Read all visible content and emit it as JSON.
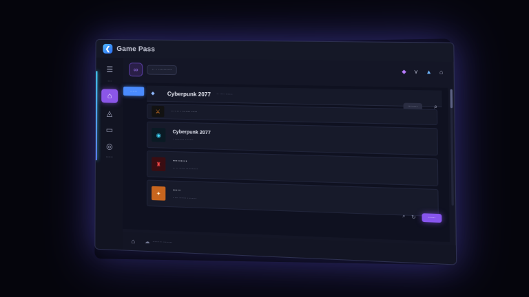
{
  "app": {
    "title": "Game Pass",
    "logo_glyph": "❮"
  },
  "sidebar": {
    "items": [
      {
        "icon": "☰",
        "name": "menu"
      },
      {
        "icon": "···",
        "name": "more"
      },
      {
        "icon": "⌂",
        "name": "home",
        "active": true
      },
      {
        "icon": "◬",
        "name": "discover"
      },
      {
        "icon": "▭",
        "name": "library"
      },
      {
        "icon": "◎",
        "name": "settings",
        "label": "......"
      }
    ]
  },
  "header": {
    "avatar_glyph": "∞",
    "user_text": "·· · ··········",
    "icons": [
      "◆",
      "⋎",
      "▲",
      "⌂"
    ]
  },
  "main": {
    "tab_label": "······",
    "now_playing": {
      "title": "Cyberpunk 2077",
      "subtitle": "·· ···· ······"
    },
    "sort_label": "········",
    "list": [
      {
        "size": "small",
        "title": "·· · ·· · ······· ·····",
        "meta": "",
        "thumb_icon": "⚔"
      },
      {
        "size": "big",
        "title": "Cyberpunk 2077",
        "meta": "· ········ ·······",
        "thumb_icon": "◉"
      },
      {
        "size": "big",
        "title": "·········",
        "meta": "·· ·· ····· ··········",
        "thumb_icon": "♜"
      },
      {
        "size": "big",
        "title": "·····",
        "meta": "· ··· ······ ········",
        "thumb_icon": "✦"
      }
    ],
    "play_label": "······"
  },
  "statusbar": {
    "home_glyph": "⌂",
    "cloud_glyph": "☁",
    "text": "········ ········"
  }
}
